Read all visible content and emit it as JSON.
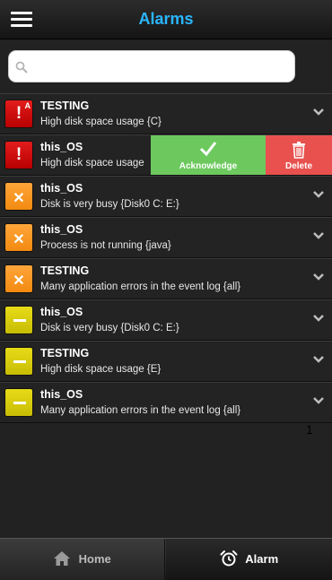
{
  "header": {
    "title": "Alarms",
    "menu_icon": "hamburger-icon"
  },
  "search": {
    "value": "",
    "placeholder": "",
    "icon": "search-icon"
  },
  "alarms": [
    {
      "severity": "critical",
      "badge": "A",
      "host": "TESTING",
      "message": "High disk space usage {C}"
    },
    {
      "severity": "critical",
      "badge": "",
      "host": "this_OS",
      "message": "High disk space usage"
    },
    {
      "severity": "major",
      "badge": "",
      "host": "this_OS",
      "message": "Disk is very busy {Disk0 C: E:}"
    },
    {
      "severity": "major",
      "badge": "",
      "host": "this_OS",
      "message": "Process is not running {java}"
    },
    {
      "severity": "major",
      "badge": "",
      "host": "TESTING",
      "message": "Many application errors in the event log {all}"
    },
    {
      "severity": "minor",
      "badge": "",
      "host": "this_OS",
      "message": "Disk is very busy {Disk0 C: E:}"
    },
    {
      "severity": "minor",
      "badge": "",
      "host": "TESTING",
      "message": "High disk space usage {E}"
    },
    {
      "severity": "minor",
      "badge": "",
      "host": "this_OS",
      "message": "Many application errors in the event log {all}"
    }
  ],
  "swipe_actions": {
    "acknowledge_label": "Acknowledge",
    "delete_label": "Delete"
  },
  "page_number": "1",
  "tabs": {
    "home_label": "Home",
    "alarm_label": "Alarm",
    "active": "Alarm"
  },
  "colors": {
    "title": "#2ab6ff",
    "critical": "#d10f0f",
    "major": "#f7941d",
    "minor": "#d9cc0b",
    "acknowledge": "#6dc95e",
    "delete": "#e8514e"
  }
}
